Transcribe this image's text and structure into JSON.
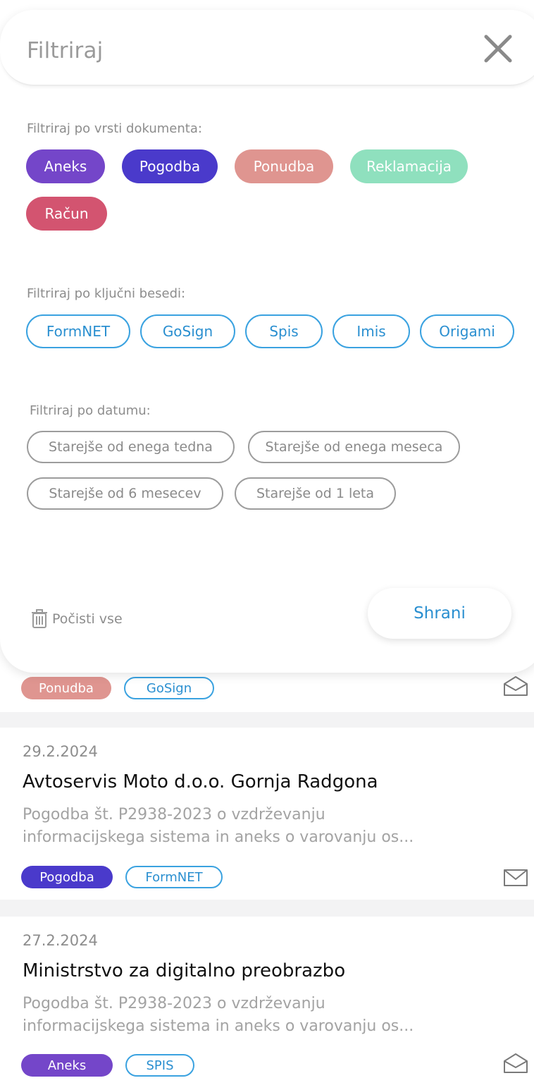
{
  "filter": {
    "title": "Filtriraj",
    "doc_type_label": "Filtriraj po vrsti dokumenta:",
    "doc_types": [
      {
        "label": "Aneks",
        "color": "#7446c9"
      },
      {
        "label": "Pogodba",
        "color": "#4a3acb"
      },
      {
        "label": "Ponudba",
        "color": "#df9590"
      },
      {
        "label": "Reklamacija",
        "color": "#8fe0be"
      },
      {
        "label": "Račun",
        "color": "#d35470"
      }
    ],
    "keyword_label": "Filtriraj po ključni besedi:",
    "keywords": [
      "FormNET",
      "GoSign",
      "Spis",
      "Imis",
      "Origami"
    ],
    "date_label": "Filtriraj po datumu:",
    "dates": [
      "Starejše od enega tedna",
      "Starejše od enega meseca",
      "Starejše od 6 mesecev",
      "Starejše od 1 leta"
    ],
    "clear_all": "Počisti vse",
    "save": "Shrani"
  },
  "cards": [
    {
      "tags": [
        {
          "label": "Ponudba",
          "style": "filled",
          "color": "#df9590"
        },
        {
          "label": "GoSign",
          "style": "outline"
        }
      ],
      "mail_icon": "mail-open-icon"
    },
    {
      "date": "29.2.2024",
      "title": "Avtoservis Moto d.o.o. Gornja Radgona",
      "desc_line1": "Pogodba št. P2938-2023 o vzdrževanju",
      "desc_line2": "informacijskega sistema in aneks o varovanju os...",
      "tags": [
        {
          "label": "Pogodba",
          "style": "filled",
          "color": "#4a3acb"
        },
        {
          "label": "FormNET",
          "style": "outline"
        }
      ],
      "mail_icon": "mail-closed-icon"
    },
    {
      "date": "27.2.2024",
      "title": "Ministrstvo za digitalno preobrazbo",
      "desc_line1": "Pogodba št. P2938-2023 o vzdrževanju",
      "desc_line2": "informacijskega sistema in aneks o varovanju os...",
      "tags": [
        {
          "label": "Aneks",
          "style": "filled",
          "color": "#7446c9"
        },
        {
          "label": "SPIS",
          "style": "outline"
        }
      ],
      "mail_icon": "mail-open-icon"
    }
  ]
}
